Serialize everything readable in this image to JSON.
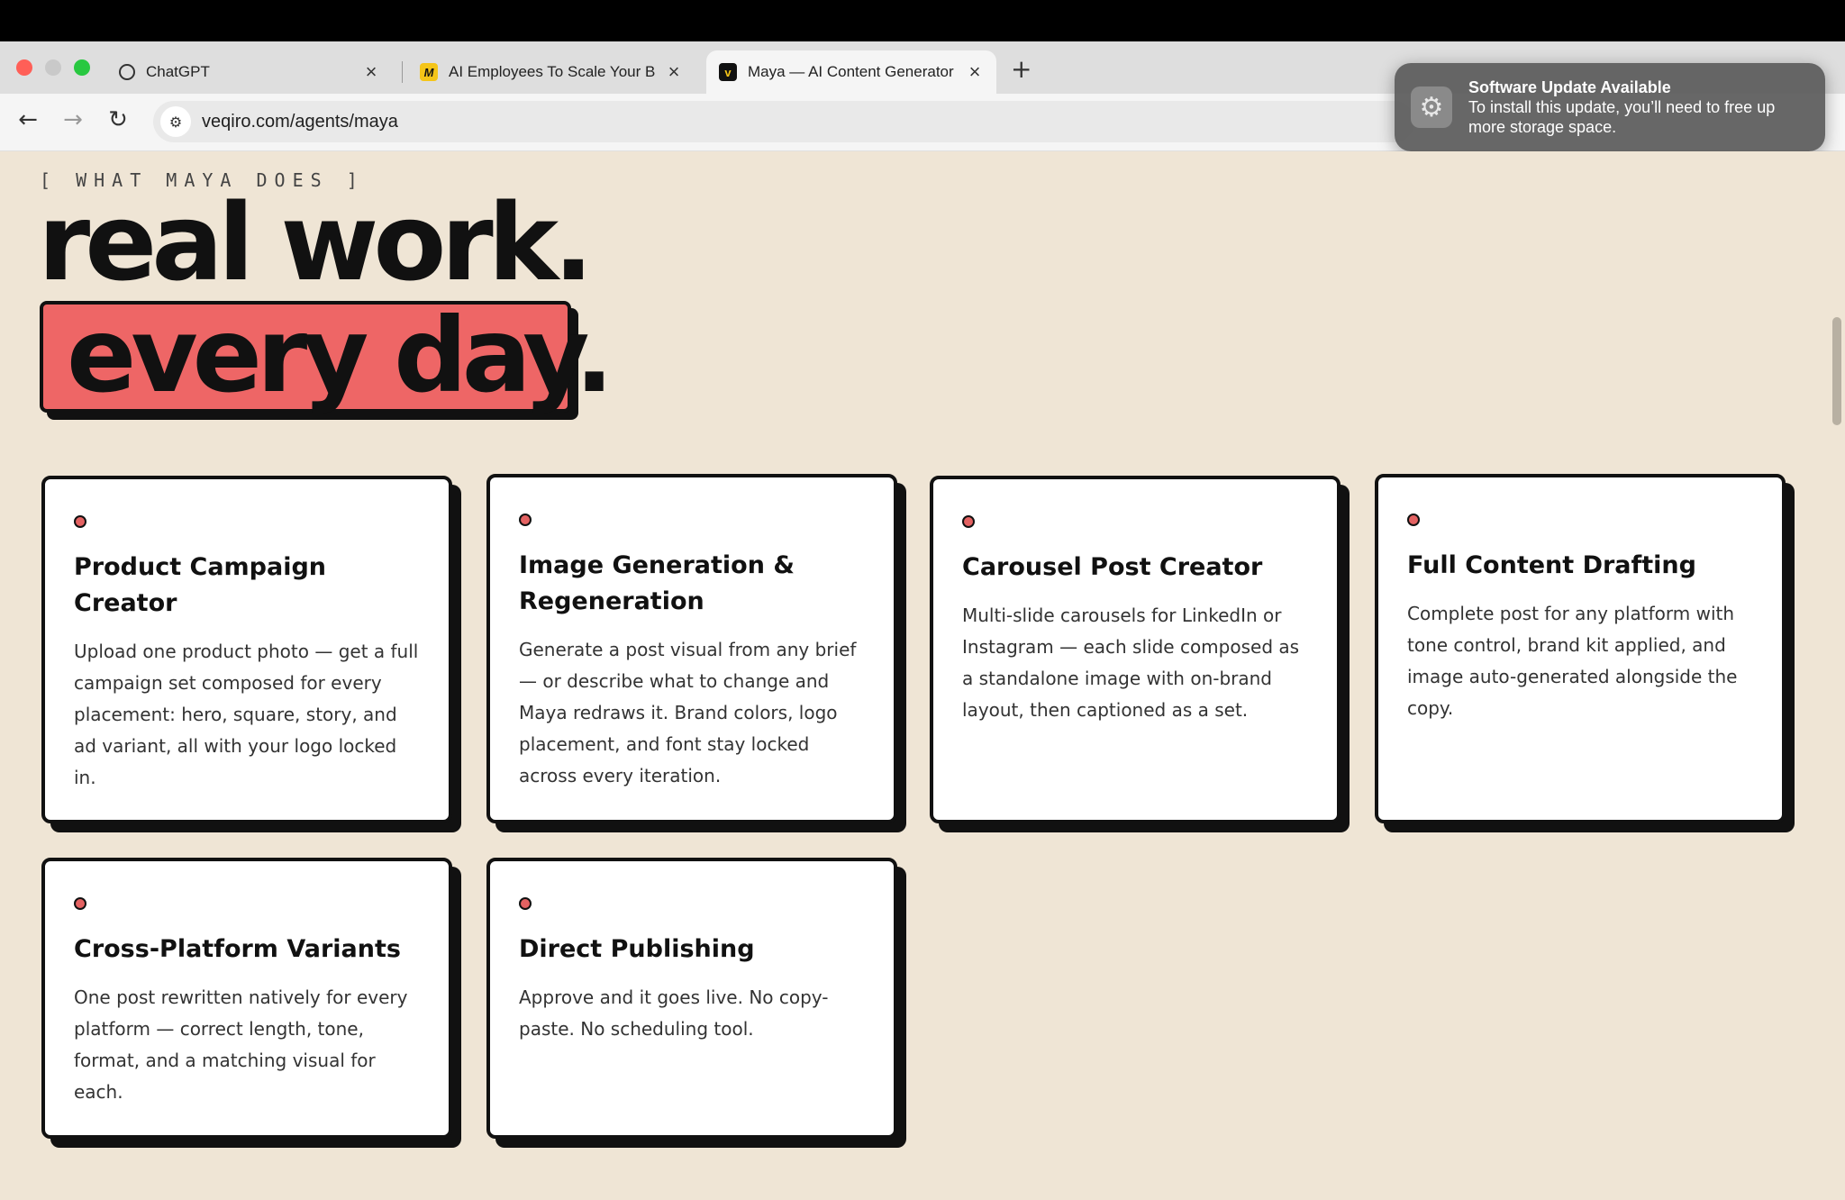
{
  "browser": {
    "tabs": [
      {
        "title": "ChatGPT",
        "icon": "chatgpt-icon",
        "close": "×"
      },
      {
        "title": "AI Employees To Scale Your B",
        "icon": "veqiro-logo-icon",
        "close": "×"
      },
      {
        "title": "Maya — AI Content Generator",
        "icon": "maya-logo-icon",
        "close": "×"
      }
    ],
    "new_tab": "+",
    "url": "veqiro.com/agents/maya"
  },
  "notification": {
    "title": "Software Update Available",
    "body": "To install this update, you’ll need to free up more storage space."
  },
  "page": {
    "eyebrow": "[ WHAT MAYA DOES ]",
    "headline_line1": "real work.",
    "headline_line2": "every day.",
    "accent_color": "#ee6666",
    "background_color": "#efe5d5",
    "cards": [
      {
        "title": "Product Campaign Creator",
        "description": "Upload one product photo — get a full campaign set composed for every placement: hero, square, story, and ad variant, all with your logo locked in."
      },
      {
        "title": "Image Generation & Regeneration",
        "description": "Generate a post visual from any brief — or describe what to change and Maya redraws it. Brand colors, logo placement, and font stay locked across every iteration."
      },
      {
        "title": "Carousel Post Creator",
        "description": "Multi-slide carousels for LinkedIn or Instagram — each slide composed as a standalone image with on-brand layout, then captioned as a set."
      },
      {
        "title": "Full Content Drafting",
        "description": "Complete post for any platform with tone control, brand kit applied, and image auto-generated alongside the copy."
      },
      {
        "title": "Cross-Platform Variants",
        "description": "One post rewritten natively for every platform — correct length, tone, format, and a matching visual for each."
      },
      {
        "title": "Direct Publishing",
        "description": "Approve and it goes live. No copy-paste. No scheduling tool."
      }
    ]
  }
}
